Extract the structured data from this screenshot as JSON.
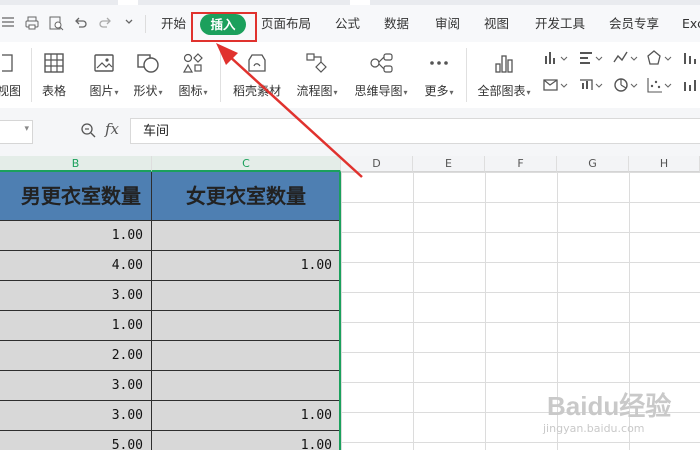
{
  "ribbon": {
    "tabs": [
      "开始",
      "插入",
      "页面布局",
      "公式",
      "数据",
      "审阅",
      "视图",
      "开发工具",
      "会员专享",
      "Exc"
    ],
    "active_tab": "插入",
    "active_color": "#1ba05c",
    "highlight_color": "#e0322e"
  },
  "tools": {
    "view": "视图",
    "table": "表格",
    "picture": "图片",
    "shape": "形状",
    "icon": "图标",
    "material": "稻壳素材",
    "flowchart": "流程图",
    "mindmap": "思维导图",
    "more": "更多",
    "all_charts": "全部图表"
  },
  "formula_bar": {
    "fx_label": "fx",
    "value": "车间"
  },
  "columns": [
    "B",
    "C",
    "D",
    "E",
    "F",
    "G",
    "H"
  ],
  "table": {
    "headers": [
      "男更衣室数量",
      "女更衣室数量"
    ],
    "rows": [
      [
        "1.00",
        ""
      ],
      [
        "4.00",
        "1.00"
      ],
      [
        "3.00",
        ""
      ],
      [
        "1.00",
        ""
      ],
      [
        "2.00",
        ""
      ],
      [
        "3.00",
        ""
      ],
      [
        "3.00",
        "1.00"
      ],
      [
        "5.00",
        "1.00"
      ]
    ],
    "header_color": "#4e7fb2",
    "cell_color": "#d8d8d8"
  },
  "watermark": {
    "text": "Baidu经验",
    "url": "jingyan.baidu.com"
  }
}
